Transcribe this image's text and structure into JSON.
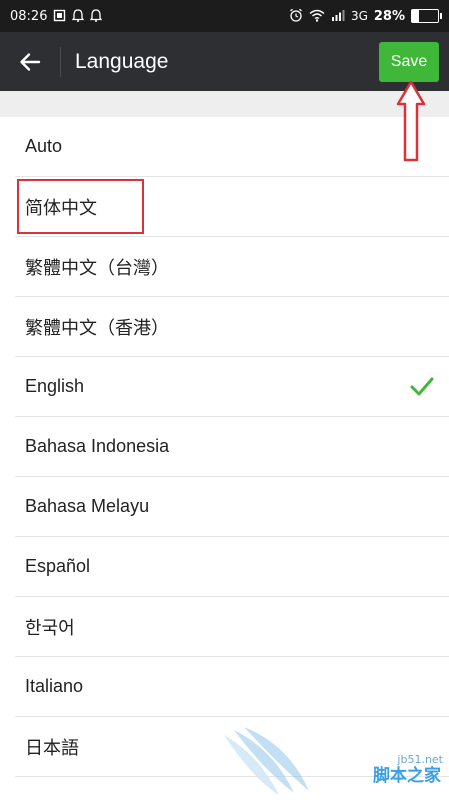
{
  "status_bar": {
    "time": "08:26",
    "network": "3G",
    "battery": "28%",
    "battery_level": 0.28,
    "left_icons": [
      "screenshot-icon",
      "notification-icon",
      "notification-icon"
    ],
    "right_icons": [
      "alarm-icon",
      "wifi-icon",
      "signal-icon"
    ]
  },
  "header": {
    "back_icon": "arrow-left-icon",
    "title": "Language",
    "save_label": "Save"
  },
  "languages": [
    {
      "label": "Auto",
      "selected": false
    },
    {
      "label": "简体中文",
      "selected": false
    },
    {
      "label": "繁體中文（台灣）",
      "selected": false
    },
    {
      "label": "繁體中文（香港）",
      "selected": false
    },
    {
      "label": "English",
      "selected": true
    },
    {
      "label": "Bahasa Indonesia",
      "selected": false
    },
    {
      "label": "Bahasa Melayu",
      "selected": false
    },
    {
      "label": "Español",
      "selected": false
    },
    {
      "label": "한국어",
      "selected": false
    },
    {
      "label": "Italiano",
      "selected": false
    },
    {
      "label": "日本語",
      "selected": false
    }
  ],
  "colors": {
    "accent": "#3fb83a",
    "header_bg": "#2d2f33",
    "status_bg": "#1c1c1c",
    "annotation": "#d9323b"
  },
  "watermark": {
    "main": "脚本之家",
    "sub": "jb51.net"
  }
}
